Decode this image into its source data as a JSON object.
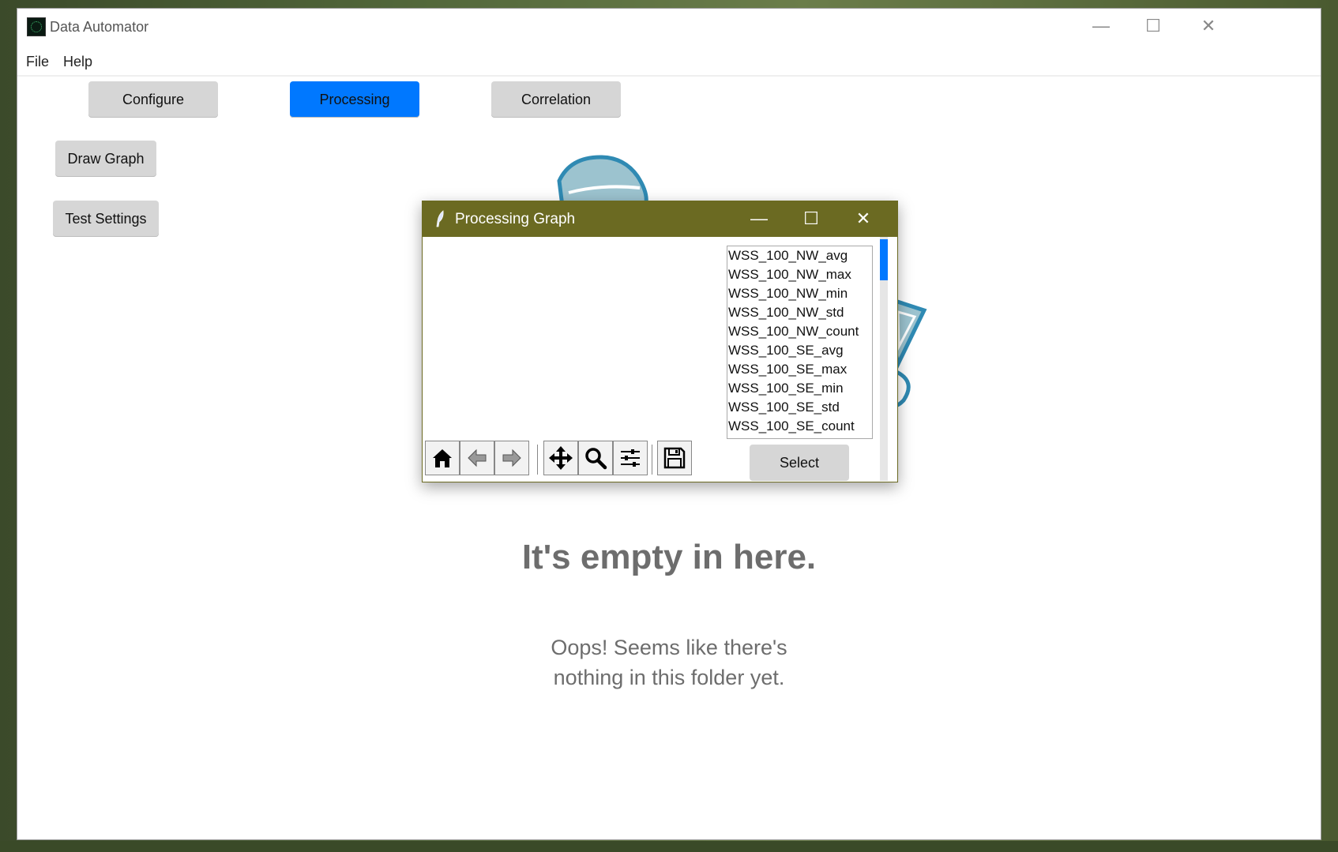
{
  "window": {
    "title": "Data Automator",
    "controls": {
      "minimize": "—",
      "maximize": "☐",
      "close": "✕"
    }
  },
  "menu": {
    "file": "File",
    "help": "Help"
  },
  "nav": {
    "configure": "Configure",
    "processing": "Processing",
    "correlation": "Correlation",
    "active": "Processing"
  },
  "side": {
    "draw_graph": "Draw Graph",
    "test_settings": "Test Settings"
  },
  "empty_state": {
    "title": "It's empty in here.",
    "line1": "Oops! Seems like there's",
    "line2": "nothing in this folder yet."
  },
  "dialog": {
    "title": "Processing Graph",
    "controls": {
      "minimize": "—",
      "maximize": "☐",
      "close": "✕"
    },
    "list_items": [
      "WSS_100_NW_avg",
      "WSS_100_NW_max",
      "WSS_100_NW_min",
      "WSS_100_NW_std",
      "WSS_100_NW_count",
      "WSS_100_SE_avg",
      "WSS_100_SE_max",
      "WSS_100_SE_min",
      "WSS_100_SE_std",
      "WSS_100_SE_count"
    ],
    "select_label": "Select",
    "toolbar_icons": [
      "home-icon",
      "back-arrow-icon",
      "forward-arrow-icon",
      "pan-icon",
      "zoom-icon",
      "subplots-config-icon",
      "save-icon"
    ]
  },
  "colors": {
    "accent": "#0078ff",
    "dialog_titlebar": "#6b6a22",
    "button_gray": "#d6d6d6",
    "empty_text": "#6d6d6d"
  }
}
